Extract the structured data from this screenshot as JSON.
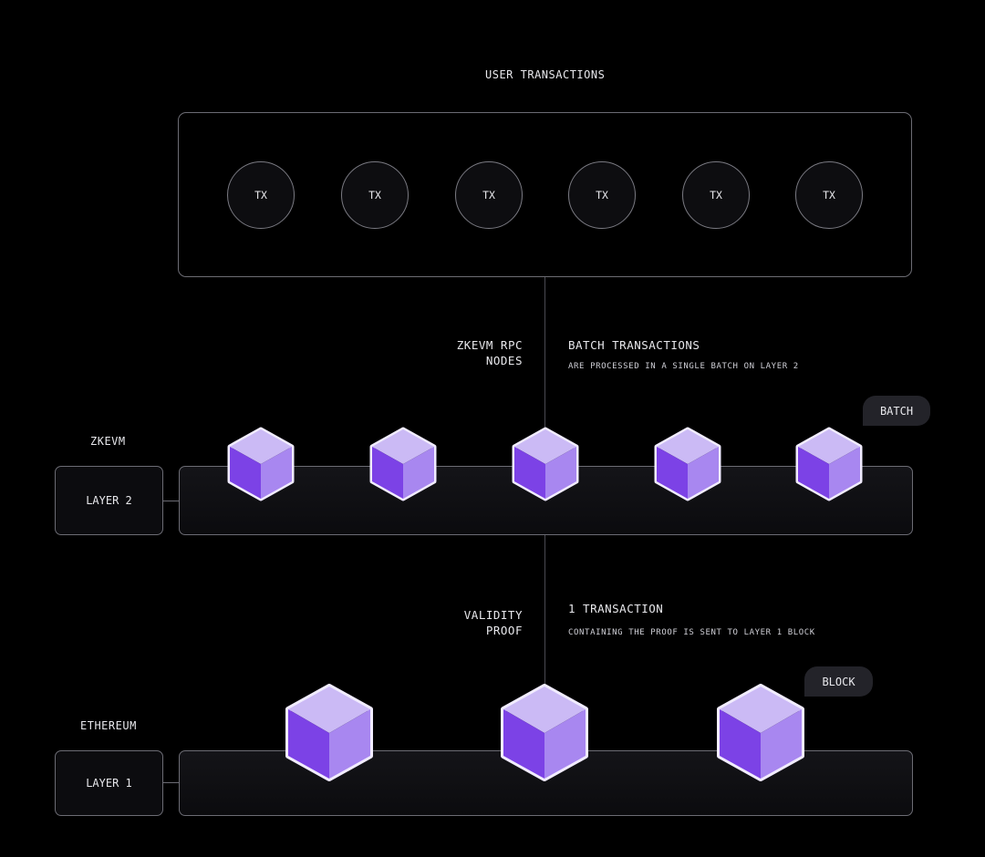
{
  "top": {
    "title": "USER TRANSACTIONS",
    "transactions": [
      "TX",
      "TX",
      "TX",
      "TX",
      "TX",
      "TX"
    ]
  },
  "rpc": {
    "side_label_line1": "ZKEVM RPC",
    "side_label_line2": "NODES",
    "heading": "BATCH TRANSACTIONS",
    "description": "ARE PROCESSED IN A SINGLE BATCH ON LAYER 2"
  },
  "layer2": {
    "network": "ZKEVM",
    "label": "LAYER 2",
    "pill": "BATCH",
    "cube_count": 5
  },
  "proof": {
    "side_label_line1": "VALIDITY",
    "side_label_line2": "PROOF",
    "heading": "1 TRANSACTION",
    "description": "CONTAINING THE PROOF IS SENT TO LAYER 1 BLOCK"
  },
  "layer1": {
    "network": "ETHEREUM",
    "label": "LAYER 1",
    "pill": "BLOCK",
    "cube_count": 3
  },
  "colors": {
    "background": "#000000",
    "cube_top": "#cbbaf5",
    "cube_left": "#7c42e6",
    "cube_right": "#a887f0",
    "cube_outline": "#f1ecff"
  }
}
